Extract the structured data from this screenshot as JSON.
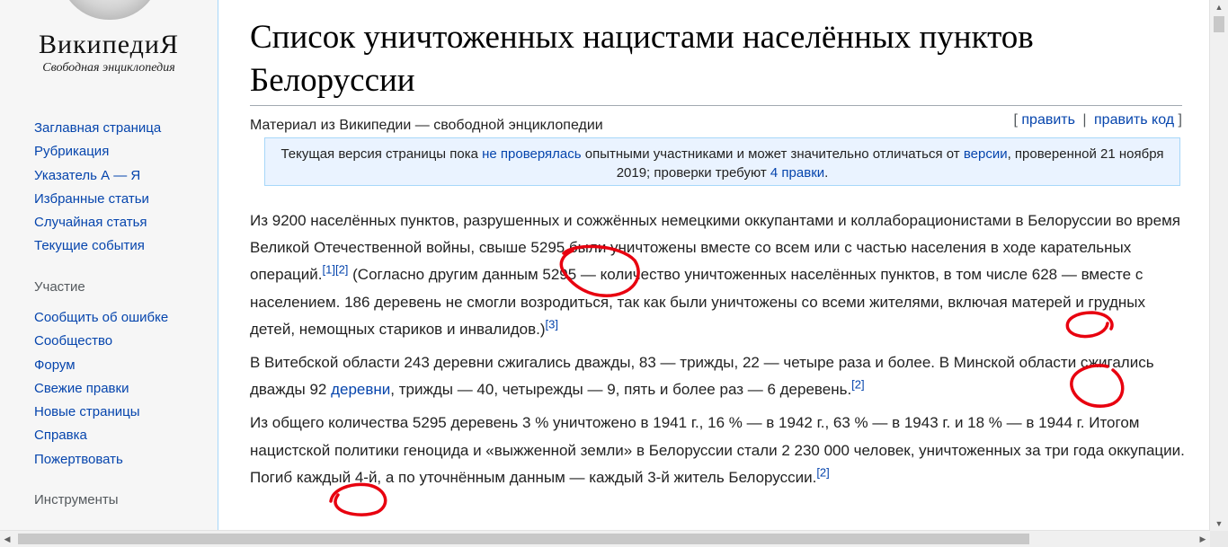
{
  "logo": {
    "title": "ВикипедиЯ",
    "subtitle": "Свободная энциклопедия"
  },
  "sidebar": {
    "navigation": [
      {
        "label": "Заглавная страница"
      },
      {
        "label": "Рубрикация"
      },
      {
        "label": "Указатель А — Я"
      },
      {
        "label": "Избранные статьи"
      },
      {
        "label": "Случайная статья"
      },
      {
        "label": "Текущие события"
      }
    ],
    "participation_heading": "Участие",
    "participation": [
      {
        "label": "Сообщить об ошибке"
      },
      {
        "label": "Сообщество"
      },
      {
        "label": "Форум"
      },
      {
        "label": "Свежие правки"
      },
      {
        "label": "Новые страницы"
      },
      {
        "label": "Справка"
      },
      {
        "label": "Пожертвовать"
      }
    ],
    "tools_heading": "Инструменты"
  },
  "page": {
    "title": "Список уничтоженных нацистами населённых пунктов Белоруссии",
    "tagline": "Материал из Википедии — свободной энциклопедии",
    "edit": {
      "open": "[",
      "edit_label": "править",
      "sep": "|",
      "edit_code_label": "править код",
      "close": "]"
    }
  },
  "notice": {
    "t1": "Текущая версия страницы пока ",
    "link1": "не проверялась",
    "t2": " опытными участниками и может значительно отличаться от ",
    "link2": "версии",
    "t3": ", проверенной 21 ноября 2019; проверки требуют ",
    "link3": "4 правки",
    "t4": "."
  },
  "article": {
    "p1": {
      "t1": "Из 9200 населённых пунктов, разрушенных и сожжённых немецкими оккупантами и коллаборационистами в Белоруссии во время Великой Отечественной войны, свыше 5295 были уничтожены вместе со всем или с частью населения в ходе карательных операций.",
      "ref1": "[1]",
      "ref2": "[2]",
      "t2": " (Согласно другим данным 5295 — количество уничтоженных населённых пунктов, в том числе 628 — вместе с населением. 186 деревень не смогли возродиться, так как были уничтожены со всеми жителями, включая матерей и грудных детей, немощных стариков и инвалидов.)",
      "ref3": "[3]"
    },
    "p2": {
      "t1": "В Витебской области 243 деревни сжигались дважды, 83 — трижды, 22 — четыре раза и более. В Минской области сжигались дважды 92 ",
      "link": "деревни",
      "t2": ", трижды — 40, четырежды — 9, пять и более раз — 6 деревень.",
      "ref": "[2]"
    },
    "p3": {
      "t1": "Из общего количества 5295 деревень 3 % уничтожено в 1941 г., 16 % — в 1942 г., 63 % — в 1943 г. и 18 % — в 1944 г. Итогом нацистской политики геноцида и «выжженной земли» в Белоруссии стали 2 230 000 человек, уничтоженных за три года оккупации. Погиб каждый 4-й, а по уточнённым данным — каждый 3-й житель Белоруссии.",
      "ref": "[2]"
    }
  },
  "colors": {
    "link": "#0645ad",
    "annotation": "#e8000f",
    "notice_bg": "#eaf3ff"
  }
}
